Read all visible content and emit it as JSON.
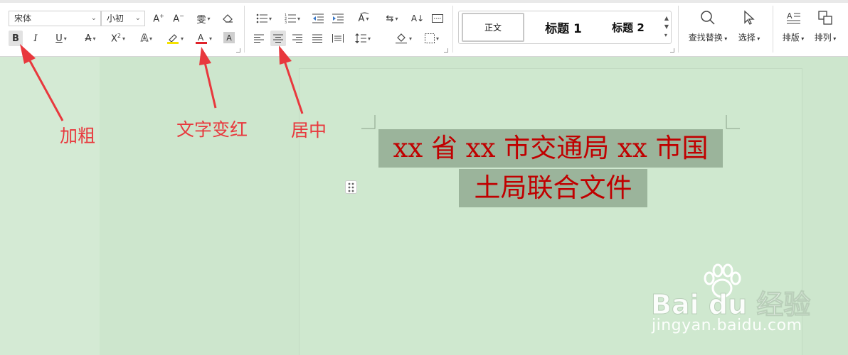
{
  "toolbar": {
    "font_family_value": "宋体",
    "font_size_value": "小初",
    "style_normal": "正文",
    "style_heading1": "标题 1",
    "style_heading2": "标题 2",
    "find_replace_label": "查找替换",
    "select_label": "选择",
    "layout_label": "排版",
    "arrange_label": "排列"
  },
  "colors": {
    "annotation": "#e8383d",
    "title_text": "#c00000",
    "highlight_bg": "#9bb49b",
    "font_color_bar": "#e0222a",
    "highlight_bar": "#f5e200",
    "eye_care_bg": "#cfe7cf"
  },
  "document": {
    "title_line1": "xx 省 xx 市交通局 xx 市国",
    "title_line2": "土局联合文件"
  },
  "annotations": {
    "bold": "加粗",
    "red_text": "文字变红",
    "center": "居中"
  },
  "watermark": {
    "brand": "Bai du 经验",
    "url": "jingyan.baidu.com"
  }
}
